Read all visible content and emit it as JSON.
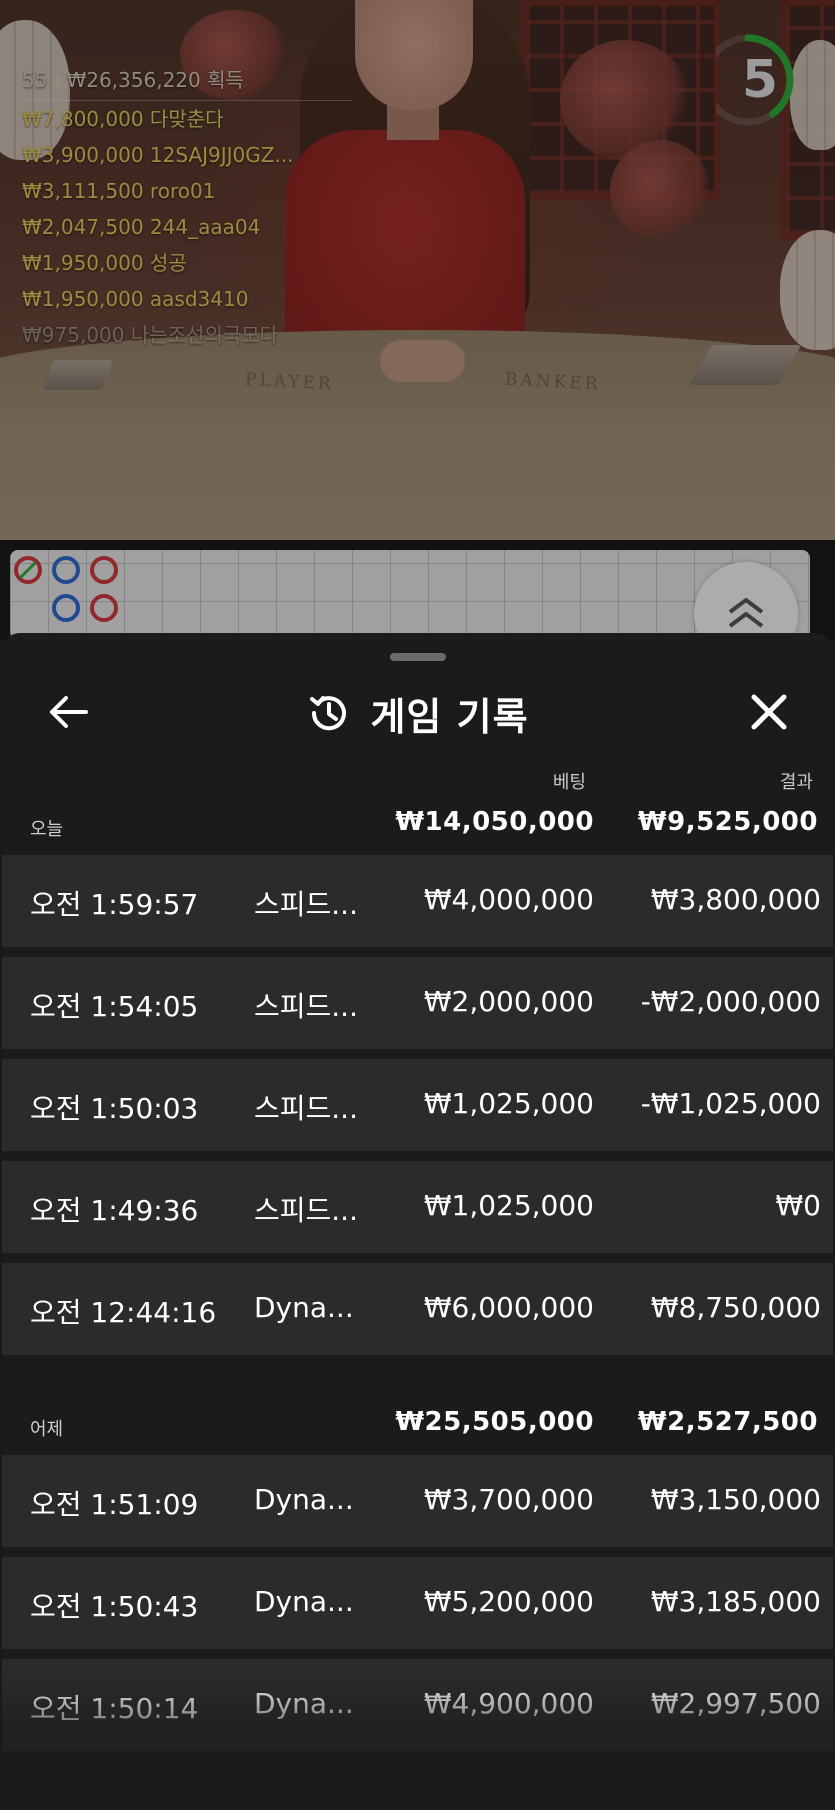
{
  "leaderboard": {
    "player_count": "55",
    "total_won": "₩26,356,220",
    "won_label": "획득",
    "entries": [
      {
        "amount": "₩7,800,000",
        "name": "다맞춘다"
      },
      {
        "amount": "₩3,900,000",
        "name": "12SAJ9JJ0GZ..."
      },
      {
        "amount": "₩3,111,500",
        "name": "roro01"
      },
      {
        "amount": "₩2,047,500",
        "name": "244_aaa04"
      },
      {
        "amount": "₩1,950,000",
        "name": "성공"
      },
      {
        "amount": "₩1,950,000",
        "name": "aasd3410"
      },
      {
        "amount": "₩975,000",
        "name": "나는조선의국모다"
      }
    ]
  },
  "table_labels": {
    "player": "PLAYER",
    "banker": "BANKER"
  },
  "timer": {
    "value": "5",
    "progress": 0.4,
    "color": "#2ea43a"
  },
  "history": {
    "title": "게임 기록",
    "columns": {
      "bet": "베팅",
      "result": "결과"
    },
    "sections": [
      {
        "label": "오늘",
        "total_bet": "₩14,050,000",
        "total_result": "₩9,525,000",
        "rows": [
          {
            "time": "오전 1:59:57",
            "game": "스피드...",
            "bet": "₩4,000,000",
            "result": "₩3,800,000"
          },
          {
            "time": "오전 1:54:05",
            "game": "스피드...",
            "bet": "₩2,000,000",
            "result": "-₩2,000,000"
          },
          {
            "time": "오전 1:50:03",
            "game": "스피드...",
            "bet": "₩1,025,000",
            "result": "-₩1,025,000"
          },
          {
            "time": "오전 1:49:36",
            "game": "스피드...",
            "bet": "₩1,025,000",
            "result": "₩0"
          },
          {
            "time": "오전 12:44:16",
            "game": "Dyna...",
            "bet": "₩6,000,000",
            "result": "₩8,750,000"
          }
        ]
      },
      {
        "label": "어제",
        "total_bet": "₩25,505,000",
        "total_result": "₩2,527,500",
        "rows": [
          {
            "time": "오전 1:51:09",
            "game": "Dyna...",
            "bet": "₩3,700,000",
            "result": "₩3,150,000"
          },
          {
            "time": "오전 1:50:43",
            "game": "Dyna...",
            "bet": "₩5,200,000",
            "result": "₩3,185,000"
          },
          {
            "time": "오전 1:50:14",
            "game": "Dyna...",
            "bet": "₩4,900,000",
            "result": "₩2,997,500"
          }
        ]
      }
    ]
  },
  "icons": {
    "back": "arrow-left-icon",
    "history": "history-clock-icon",
    "close": "close-icon",
    "expand": "double-chevron-up-icon"
  },
  "colors": {
    "sheet_bg": "#1b1b1b",
    "row_bg": "#2b2b2b",
    "leaderboard_gold": "#d9c35a"
  }
}
